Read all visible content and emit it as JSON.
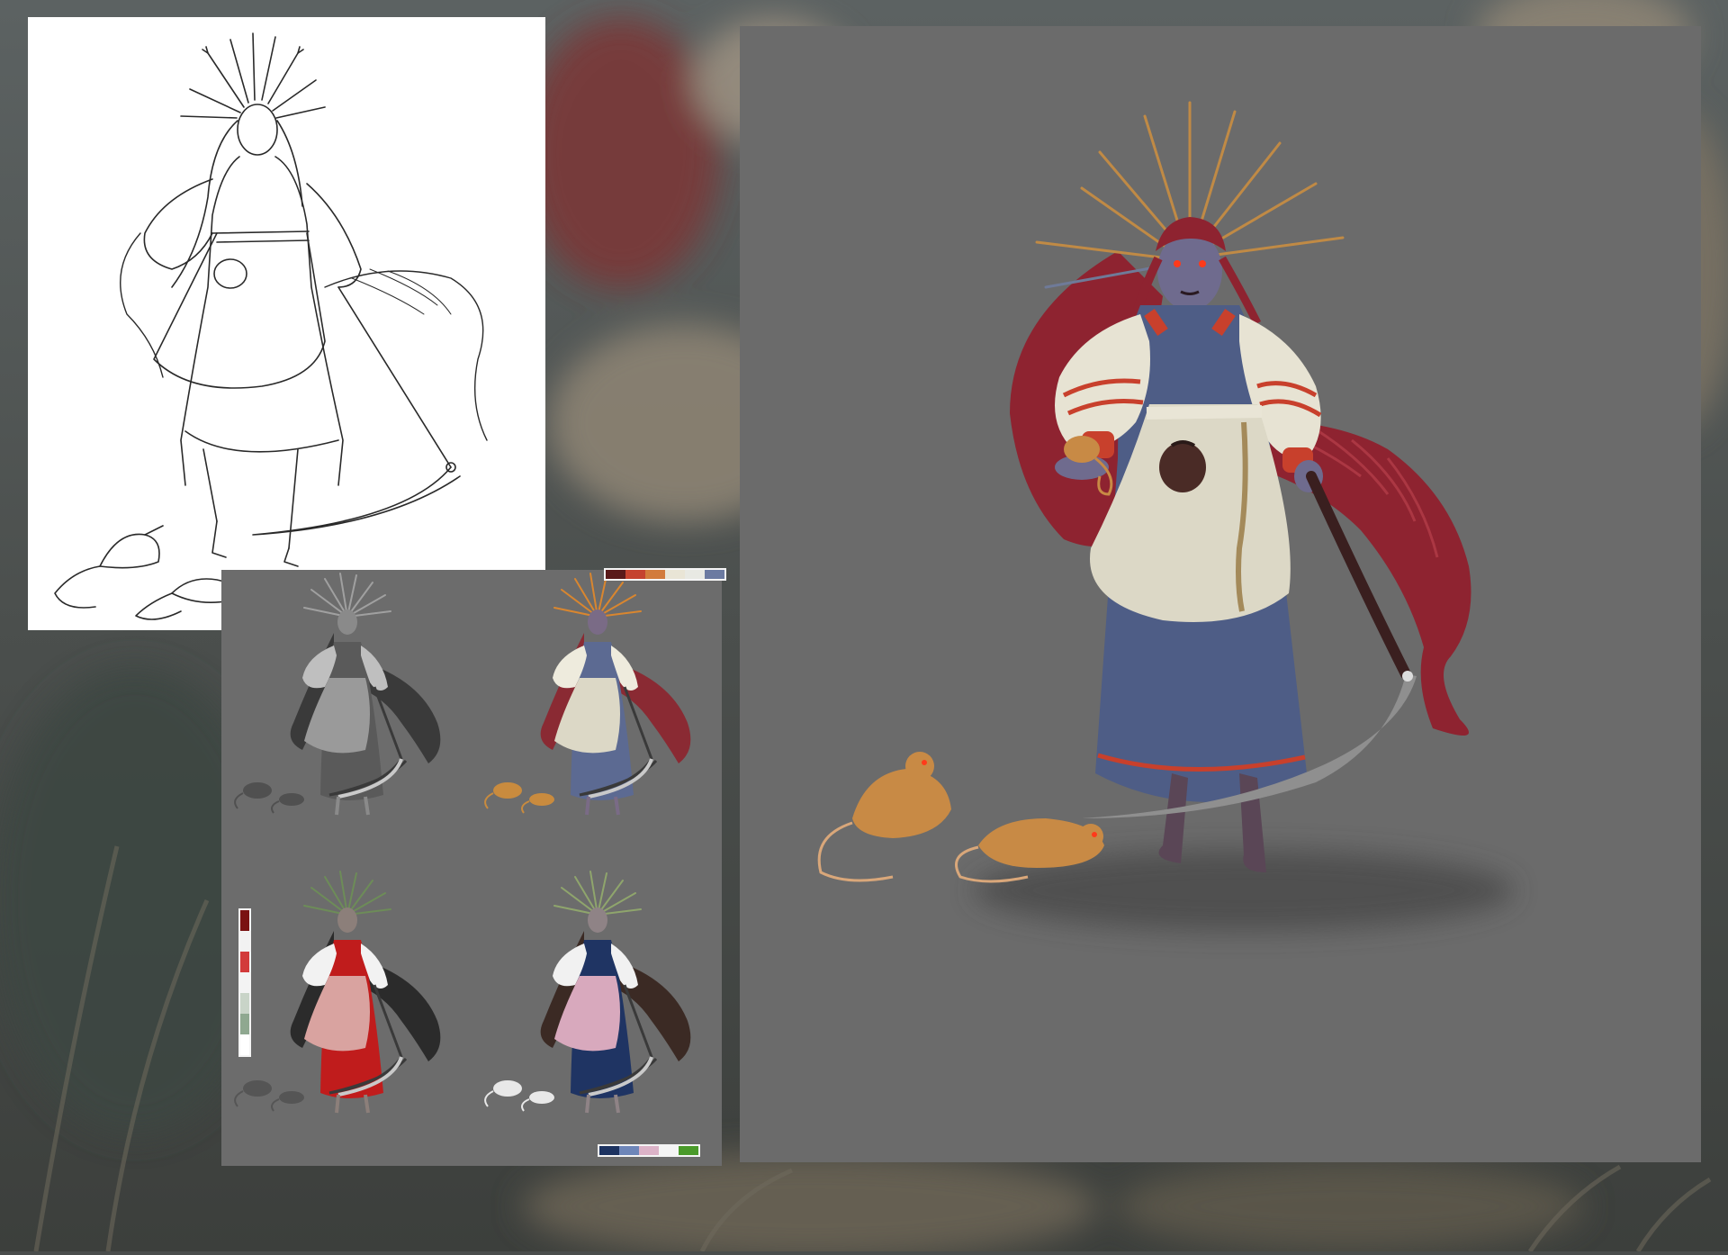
{
  "background": {
    "base_color": "#4a4d4c",
    "tones": [
      "#3e4443",
      "#5b5f5c",
      "#6f3b3a",
      "#8a7e6e",
      "#6a6355"
    ]
  },
  "lineart": {
    "paper_color": "#ffffff",
    "ink_color": "#2a2a2a"
  },
  "variants": {
    "panel_color": "#6c6c6c",
    "palettes": {
      "top_right": [
        "#5a1a1a",
        "#c5432f",
        "#d27b3c",
        "#e9e5d6",
        "#e8e9e3",
        "#6b7aa1"
      ],
      "left_vertical": [
        "#7a1212",
        "#f2f2f2",
        "#d23a3a",
        "#f3f3f3",
        "#c9d4c8",
        "#8fa890",
        "#ffffff"
      ],
      "bottom_right": [
        "#1d3361",
        "#6e86b9",
        "#dcb3c8",
        "#f4f4f4",
        "#4a9a2a"
      ]
    },
    "colorways": [
      {
        "name": "grayscale",
        "skin": "#8a8a8a",
        "hair": "#3a3a3a",
        "dress": "#5a5a5a",
        "apron": "#9a9a9a",
        "sleeve": "#bfbfbf",
        "crown": "#a0a0a0",
        "rat": "#505050"
      },
      {
        "name": "warm",
        "skin": "#7a6b86",
        "hair": "#8a2a33",
        "dress": "#5c6a92",
        "apron": "#dcd8c6",
        "sleeve": "#eeebdd",
        "crown": "#d9862f",
        "rat": "#c98b3e"
      },
      {
        "name": "red",
        "skin": "#8c7f7a",
        "hair": "#2b2b2b",
        "dress": "#c01c1c",
        "apron": "#d9a3a0",
        "sleeve": "#f2f2f2",
        "crown": "#6d8c58",
        "rat": "#555555"
      },
      {
        "name": "blue",
        "skin": "#8f8386",
        "hair": "#3b2a24",
        "dress": "#1f3463",
        "apron": "#d8a9bd",
        "sleeve": "#f1f1f1",
        "crown": "#8fa56c",
        "rat": "#e8e8e8"
      }
    ]
  },
  "final": {
    "panel_color": "#6b6b6b",
    "skin": "#6f6b8e",
    "hair": "#8e2330",
    "dress": "#4e5d86",
    "apron": "#dcd8c6",
    "sleeve": "#e7e3d3",
    "trim": "#c8402c",
    "crown": "#c08a45",
    "scythe": "#8f8f8f",
    "handle": "#3a1f1f",
    "pouch": "#4a2b26",
    "rat": "#c88a45",
    "eyes": "#ff3a1a"
  }
}
